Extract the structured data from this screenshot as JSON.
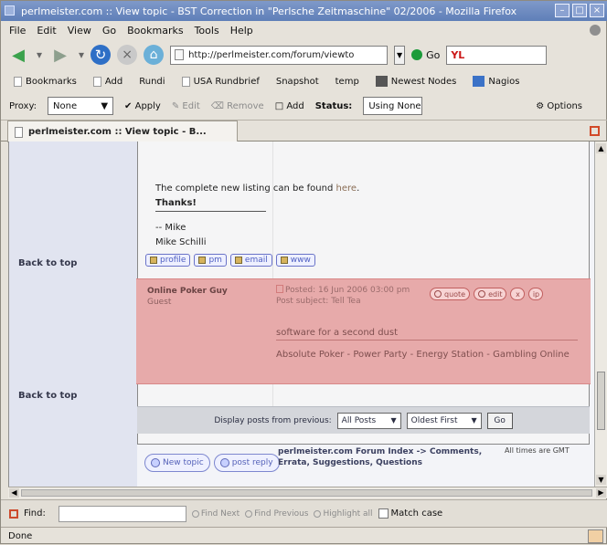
{
  "window": {
    "title": "perlmeister.com :: View topic - BST Correction in \"Perlsche Zeitmaschine\" 02/2006 - Mozilla Firefox"
  },
  "menu": [
    "File",
    "Edit",
    "View",
    "Go",
    "Bookmarks",
    "Tools",
    "Help"
  ],
  "nav": {
    "url": "http://perlmeister.com/forum/viewto",
    "go_label": "Go",
    "search_value": "YL"
  },
  "bookmarks": [
    "Bookmarks",
    "Add",
    "Rundi",
    "USA Rundbrief",
    "Snapshot",
    "temp",
    "Newest Nodes",
    "Nagios"
  ],
  "proxy": {
    "label": "Proxy:",
    "value": "None",
    "apply": "Apply",
    "edit": "Edit",
    "remove": "Remove",
    "add": "Add",
    "status_label": "Status:",
    "status_value": "Using None",
    "options": "Options"
  },
  "tab": {
    "title": "perlmeister.com :: View topic - B..."
  },
  "post1": {
    "line1_prefix": "The complete new listing can be found ",
    "line1_link": "here",
    "line1_suffix": ".",
    "line2": "Thanks!",
    "line3": "-- Mike",
    "line4": "Mike Schilli",
    "backtotop": "Back to top",
    "buttons": [
      "profile",
      "pm",
      "email",
      "www"
    ]
  },
  "post2": {
    "author": "Online Poker Guy",
    "rank": "Guest",
    "posted": "Posted: 16 Jun 2006 03:00 pm",
    "subject": "Post subject: Tell Tea",
    "body": "software for a second dust",
    "signature": "Absolute Poker - Power Party - Energy Station - Gambling Online",
    "actions": [
      "quote",
      "edit",
      "x",
      "ip"
    ],
    "backtotop": "Back to top"
  },
  "posts_controls": {
    "label": "Display posts from previous:",
    "days_value": "All Posts",
    "order_value": "Oldest First",
    "go": "Go"
  },
  "footer": {
    "newtopic": "New topic",
    "postreply": "post reply",
    "breadcrumb": "perlmeister.com Forum Index -> Comments, Errata, Suggestions, Questions",
    "timezone": "All times are GMT"
  },
  "findbar": {
    "label": "Find:",
    "next": "Find Next",
    "previous": "Find Previous",
    "highlight": "Highlight all",
    "matchcase": "Match case"
  },
  "status": {
    "text": "Done"
  }
}
